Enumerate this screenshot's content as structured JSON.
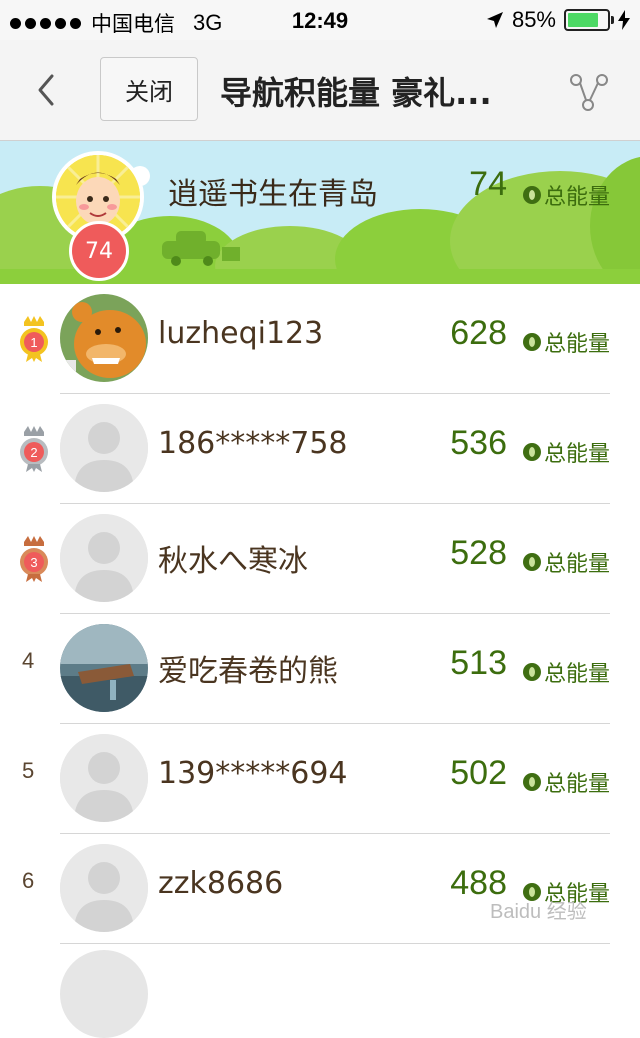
{
  "status_bar": {
    "carrier": "中国电信",
    "network": "3G",
    "time": "12:49",
    "battery": "85%"
  },
  "nav": {
    "close_label": "关闭",
    "title": "导航积能量 豪礼..."
  },
  "me": {
    "name": "逍遥书生在青岛",
    "score": "74",
    "rank_badge": "74",
    "energy_label": "总能量"
  },
  "leaderboard": [
    {
      "rank": "1",
      "name": "luzheqi123",
      "score": "628",
      "energy_label": "总能量"
    },
    {
      "rank": "2",
      "name": "186*****758",
      "score": "536",
      "energy_label": "总能量"
    },
    {
      "rank": "3",
      "name": "秋水へ寒冰",
      "score": "528",
      "energy_label": "总能量"
    },
    {
      "rank": "4",
      "name": "爱吃春卷的熊",
      "score": "513",
      "energy_label": "总能量"
    },
    {
      "rank": "5",
      "name": "139*****694",
      "score": "502",
      "energy_label": "总能量"
    },
    {
      "rank": "6",
      "name": "zzk8686",
      "score": "488",
      "energy_label": "总能量"
    }
  ],
  "watermark": "Baidu 经验",
  "colors": {
    "score_green": "#3c6d0e",
    "banner_sky": "#c8ecf6",
    "banner_hill": "#8ccf3c",
    "badge_red": "#ef5b5b",
    "gold": "#f3c320",
    "silver": "#9aa0a6",
    "bronze": "#c76d3e"
  }
}
